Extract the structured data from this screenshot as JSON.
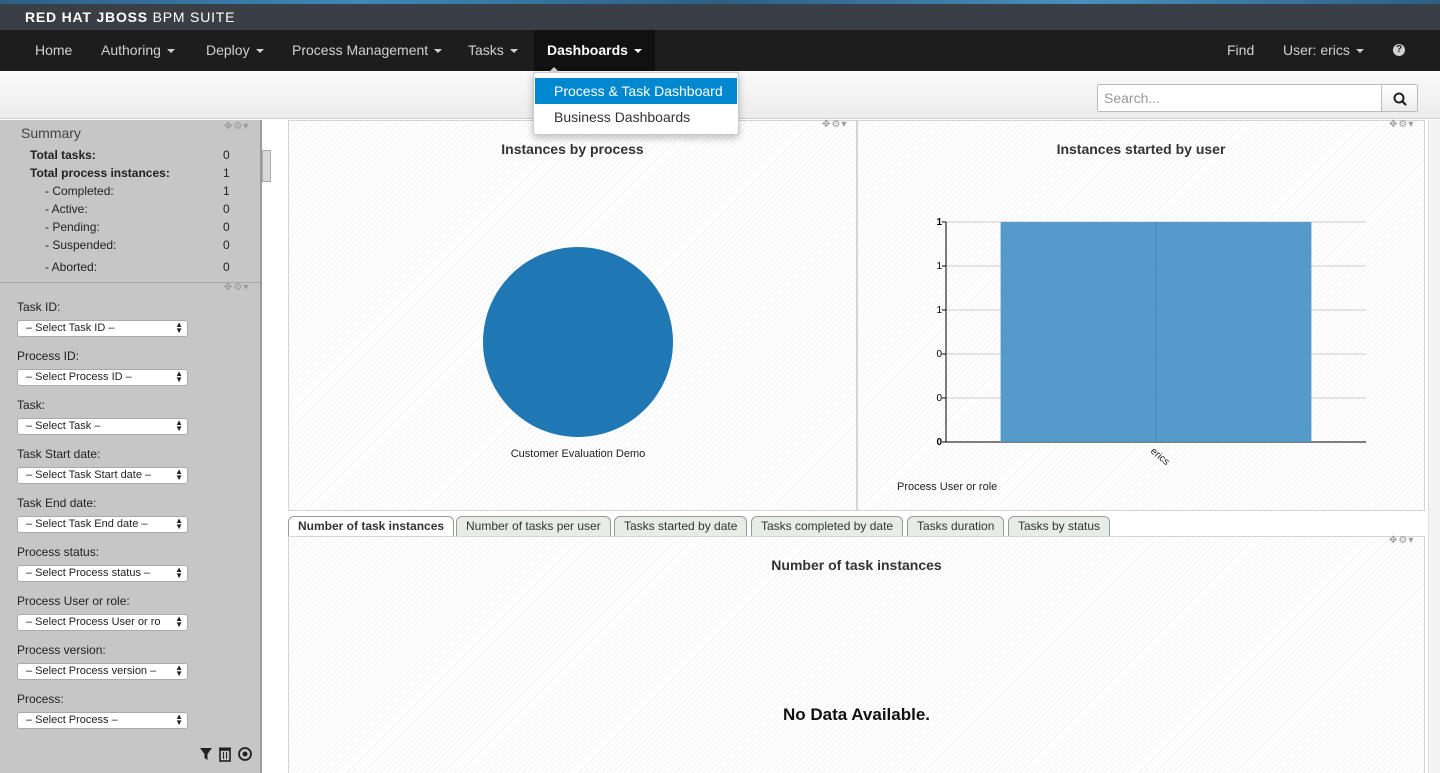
{
  "brand": {
    "bold": "RED HAT JBOSS",
    "rest": " BPM SUITE"
  },
  "nav": {
    "items": [
      "Home",
      "Authoring",
      "Deploy",
      "Process Management",
      "Tasks",
      "Dashboards"
    ],
    "find": "Find",
    "user": "User: erics",
    "help": "?"
  },
  "search": {
    "placeholder": "Search..."
  },
  "dropdown": {
    "items": [
      "Process & Task Dashboard",
      "Business Dashboards"
    ]
  },
  "summary": {
    "title": "Summary",
    "rows": [
      {
        "label": "Total tasks:",
        "value": "0"
      },
      {
        "label": "Total process instances:",
        "value": "1"
      },
      {
        "label": "- Completed:",
        "value": "1"
      },
      {
        "label": "- Active:",
        "value": "0"
      },
      {
        "label": "- Pending:",
        "value": "0"
      },
      {
        "label": "- Suspended:",
        "value": "0"
      },
      {
        "label": "- Aborted:",
        "value": "0"
      }
    ]
  },
  "filters": [
    {
      "label": "Task ID:",
      "value": "– Select Task ID –"
    },
    {
      "label": "Process ID:",
      "value": "– Select Process ID –"
    },
    {
      "label": "Task:",
      "value": "– Select Task –"
    },
    {
      "label": "Task Start date:",
      "value": "– Select Task Start date –"
    },
    {
      "label": "Task End date:",
      "value": "– Select Task End date –"
    },
    {
      "label": "Process status:",
      "value": "– Select Process status –"
    },
    {
      "label": "Process User or role:",
      "value": "– Select Process User or ro"
    },
    {
      "label": "Process version:",
      "value": "– Select Process version –"
    },
    {
      "label": "Process:",
      "value": "– Select Process –"
    }
  ],
  "chart_data": [
    {
      "type": "pie",
      "title": "Instances by process",
      "categories": [
        "Customer Evaluation Demo"
      ],
      "values": [
        1
      ],
      "colors": [
        "#1f77b4"
      ]
    },
    {
      "type": "bar",
      "title": "Instances started by user",
      "categories": [
        "erics"
      ],
      "values": [
        1
      ],
      "ylim": [
        0,
        1
      ],
      "yticks": [
        "0",
        "0",
        "0",
        "1",
        "1",
        "1"
      ],
      "xlabel": "Process User or role",
      "grid": true,
      "colors": [
        "#4b96c8"
      ]
    }
  ],
  "tabs": [
    "Number of task instances",
    "Number of tasks per user",
    "Tasks started by date",
    "Tasks completed by date",
    "Tasks duration",
    "Tasks by status"
  ],
  "bottom_panel": {
    "title": "Number of task instances",
    "message": "No Data Available."
  },
  "colors": {
    "nav_bg": "#1d1d1d",
    "brand_bg": "#393f44",
    "accent": "#0088ce",
    "sidebar_bg": "#c6c6c6"
  }
}
